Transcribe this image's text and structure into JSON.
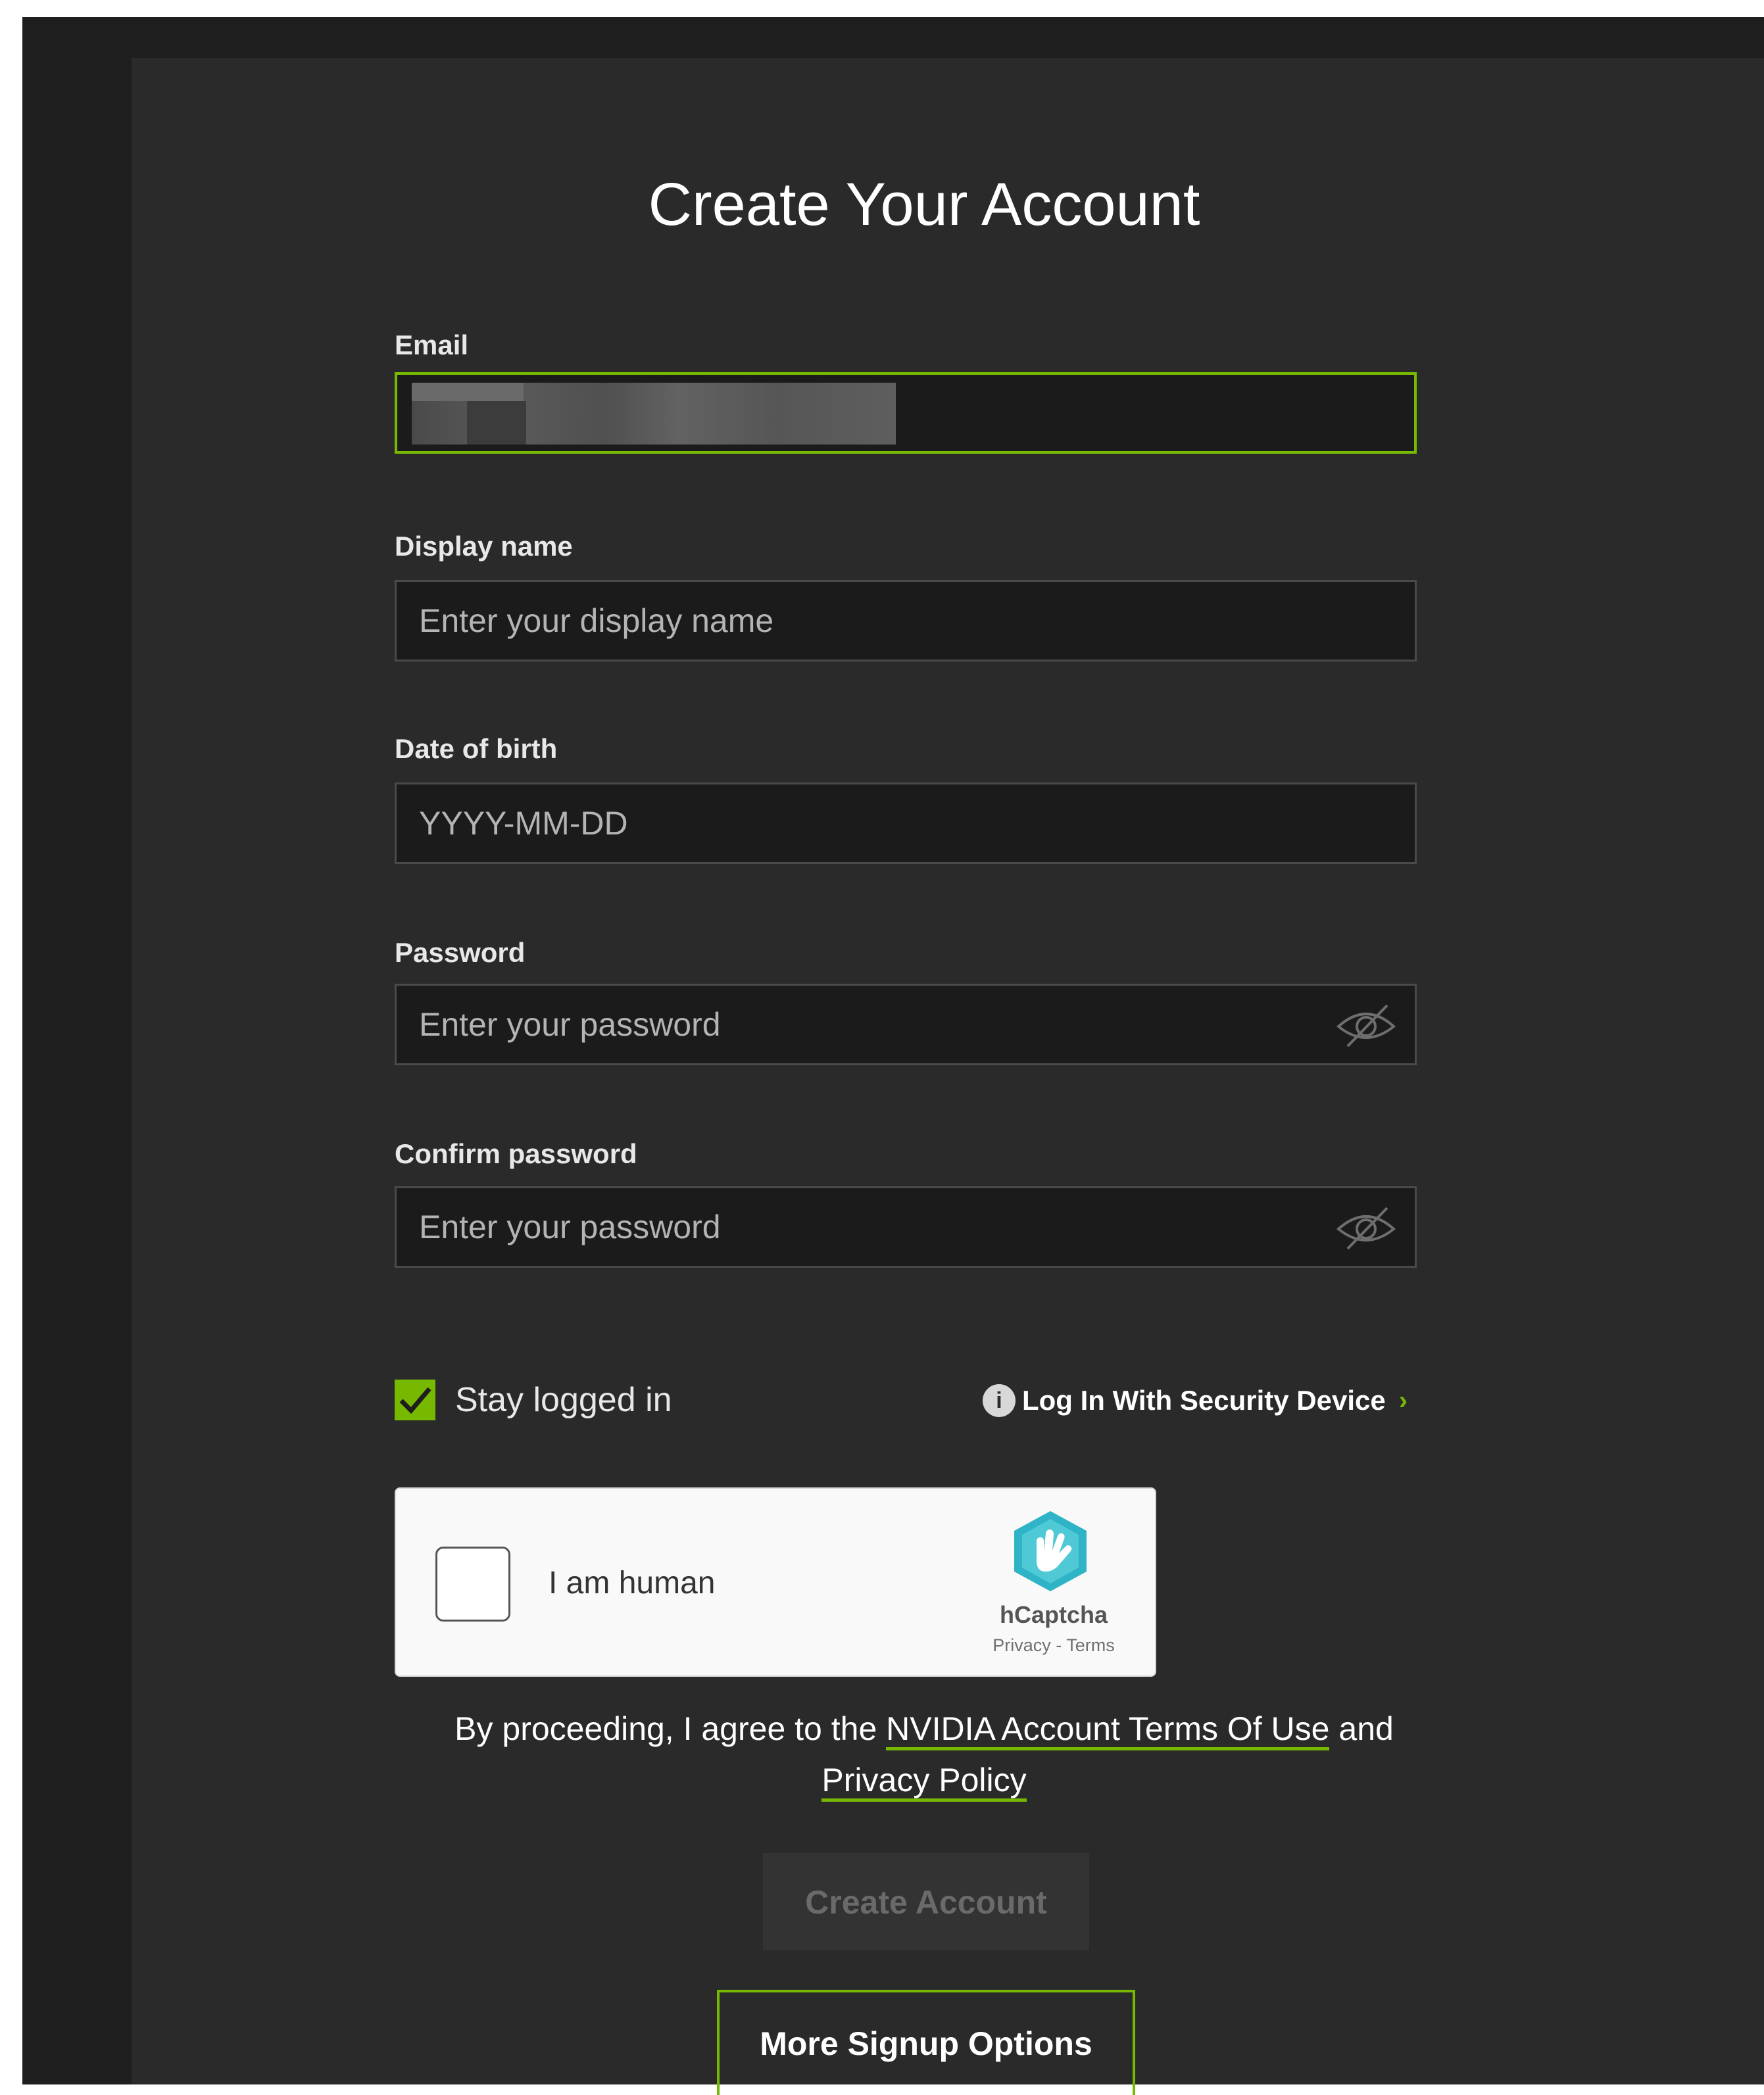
{
  "page": {
    "title": "Create Your Account"
  },
  "form": {
    "email": {
      "label": "Email",
      "value": ""
    },
    "display_name": {
      "label": "Display name",
      "placeholder": "Enter your display name"
    },
    "date_of_birth": {
      "label": "Date of birth",
      "placeholder": "YYYY-MM-DD"
    },
    "password": {
      "label": "Password",
      "placeholder": "Enter your password"
    },
    "confirm_password": {
      "label": "Confirm password",
      "placeholder": "Enter your password"
    },
    "stay_logged_in": {
      "label": "Stay logged in",
      "checked": true
    },
    "security_device": {
      "icon_glyph": "i",
      "label": "Log In With Security Device",
      "chevron": "›"
    }
  },
  "captcha": {
    "label": "I am human",
    "brand": "hCaptcha",
    "links": "Privacy - Terms"
  },
  "agreement": {
    "prefix": "By proceeding, I agree to the",
    "terms_link": "NVIDIA Account Terms Of Use",
    "conjunction": "and",
    "privacy_link": "Privacy Policy"
  },
  "buttons": {
    "create_account": "Create Account",
    "more_signup_options": "More Signup Options"
  },
  "colors": {
    "accent": "#76b900",
    "panel_background": "#2a2a2a",
    "field_background": "#1b1b1b"
  },
  "icons": {
    "password_toggle": "eye-slash-icon",
    "info": "info-icon",
    "captcha_logo": "hcaptcha-logo-icon",
    "checkbox": "checkmark-icon"
  }
}
